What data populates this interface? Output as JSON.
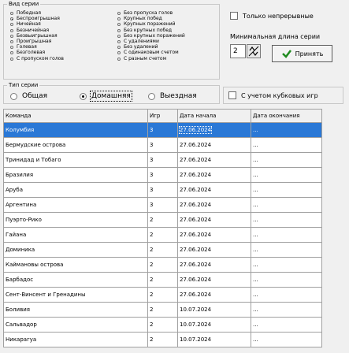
{
  "series_kind": {
    "title": "Вид серии",
    "left_options": [
      "Победная",
      "Беспроигрышная",
      "Ничейная",
      "Безничейная",
      "Безвыигрышная",
      "Проигрышная",
      "Голевая",
      "Безголевая",
      "С пропуском голов"
    ],
    "right_options": [
      "Без пропуска голов",
      "Крупных побед",
      "Крупных поражений",
      "Без крупных побед",
      "Без крупных поражений",
      "С удалениями",
      "Без удалений",
      "С одинаковым счетом",
      "С разным счетом"
    ],
    "selected": "Беспроигрышная"
  },
  "only_continuous": {
    "label": "Только непрерывные"
  },
  "min_length": {
    "label": "Минимальная длина серии",
    "value": "2"
  },
  "accept_button": {
    "label": "Принять"
  },
  "series_type": {
    "title": "Тип серии",
    "options": [
      "Общая",
      "Домашняя",
      "Выездная"
    ],
    "selected": "Домашняя"
  },
  "cup_games": {
    "label": "С учетом кубковых игр"
  },
  "table": {
    "columns": [
      "Команда",
      "Игр",
      "Дата начала",
      "Дата окончания"
    ],
    "rows": [
      [
        "Колумбия",
        "3",
        "27.06.2024",
        "..."
      ],
      [
        "Бермудские острова",
        "3",
        "27.06.2024",
        "..."
      ],
      [
        "Тринидад и Тобаго",
        "3",
        "27.06.2024",
        "..."
      ],
      [
        "Бразилия",
        "3",
        "27.06.2024",
        "..."
      ],
      [
        "Аруба",
        "3",
        "27.06.2024",
        "..."
      ],
      [
        "Аргентина",
        "3",
        "27.06.2024",
        "..."
      ],
      [
        "Пуэрто-Рико",
        "2",
        "27.06.2024",
        "..."
      ],
      [
        "Гайана",
        "2",
        "27.06.2024",
        "..."
      ],
      [
        "Доминика",
        "2",
        "27.06.2024",
        "..."
      ],
      [
        "Каймановы острова",
        "2",
        "27.06.2024",
        "..."
      ],
      [
        "Барбадос",
        "2",
        "27.06.2024",
        "..."
      ],
      [
        "Сент-Винсент и Гренадины",
        "2",
        "27.06.2024",
        "..."
      ],
      [
        "Боливия",
        "2",
        "10.07.2024",
        "..."
      ],
      [
        "Сальвадор",
        "2",
        "10.07.2024",
        "..."
      ],
      [
        "Никарагуа",
        "2",
        "10.07.2024",
        "..."
      ]
    ],
    "selected_row": 0
  },
  "colors": {
    "selection": "#2a78d6",
    "accept_check": "#1e8a1e"
  }
}
